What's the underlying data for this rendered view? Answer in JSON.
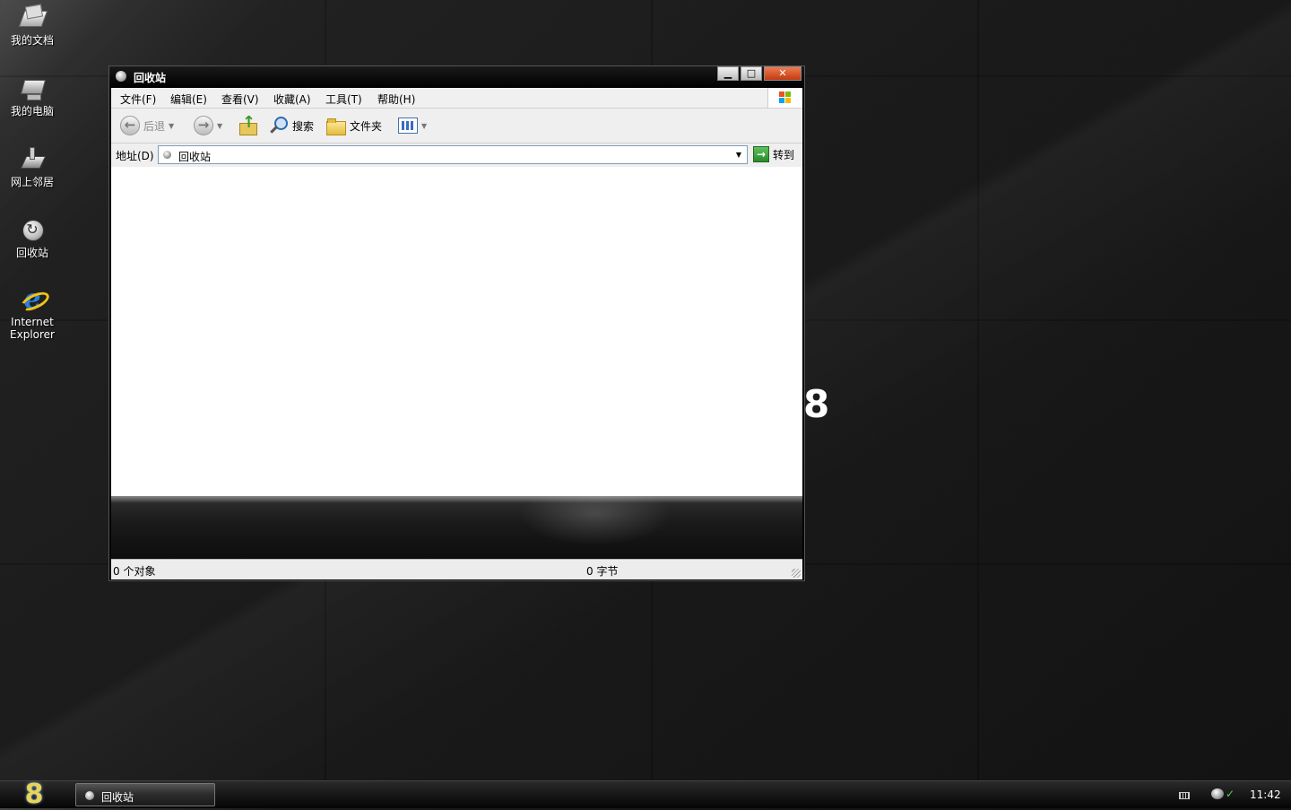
{
  "desktop": {
    "icons": [
      {
        "label": "我的文档"
      },
      {
        "label": "我的电脑"
      },
      {
        "label": "网上邻居"
      },
      {
        "label": "回收站"
      },
      {
        "label_line1": "Internet",
        "label_line2": "Explorer",
        "glyph": "e"
      }
    ],
    "decoration_glyph": "8"
  },
  "window": {
    "title": "回收站",
    "buttons": {
      "minimize": "▁",
      "maximize": "□",
      "close": "✕"
    },
    "menu": [
      "文件(F)",
      "编辑(E)",
      "查看(V)",
      "收藏(A)",
      "工具(T)",
      "帮助(H)"
    ],
    "toolbar": {
      "back_label": "后退",
      "back_glyph": "←",
      "forward_glyph": "→",
      "caret": "▼",
      "search_label": "搜索",
      "folders_label": "文件夹"
    },
    "address": {
      "label": "地址(D)",
      "value": "回收站",
      "go_label": "转到",
      "go_glyph": "→",
      "drop_glyph": "▼"
    },
    "status": {
      "objects": "0 个对象",
      "bytes": "0 字节"
    }
  },
  "taskbar": {
    "start_glyph": "8",
    "task_label": "回收站",
    "clock": "11:42"
  },
  "colors": {
    "xp_logo": [
      "#f25022",
      "#7fba00",
      "#00a4ef",
      "#ffb900"
    ],
    "close_button": "#d94f24"
  }
}
